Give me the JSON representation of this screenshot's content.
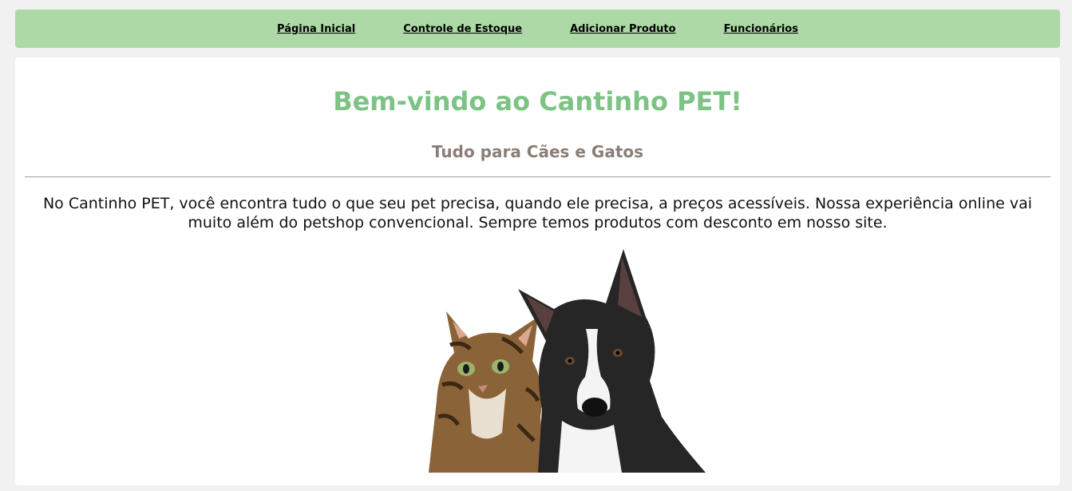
{
  "nav": {
    "items": [
      {
        "label": "Página Inicial"
      },
      {
        "label": "Controle de Estoque"
      },
      {
        "label": "Adicionar Produto"
      },
      {
        "label": "Funcionários"
      }
    ]
  },
  "main": {
    "title": "Bem-vindo ao Cantinho PET!",
    "subtitle": "Tudo para Cães e Gatos",
    "intro": "No Cantinho PET, você encontra tudo o que seu pet precisa, quando ele precisa, a preços acessíveis. Nossa experiência online vai muito além do petshop convencional. Sempre temos produtos com desconto em nosso site."
  },
  "colors": {
    "nav_bg": "#add9a6",
    "title": "#7cc384",
    "subtitle": "#8a7f77",
    "page_bg": "#f1f1f1"
  }
}
